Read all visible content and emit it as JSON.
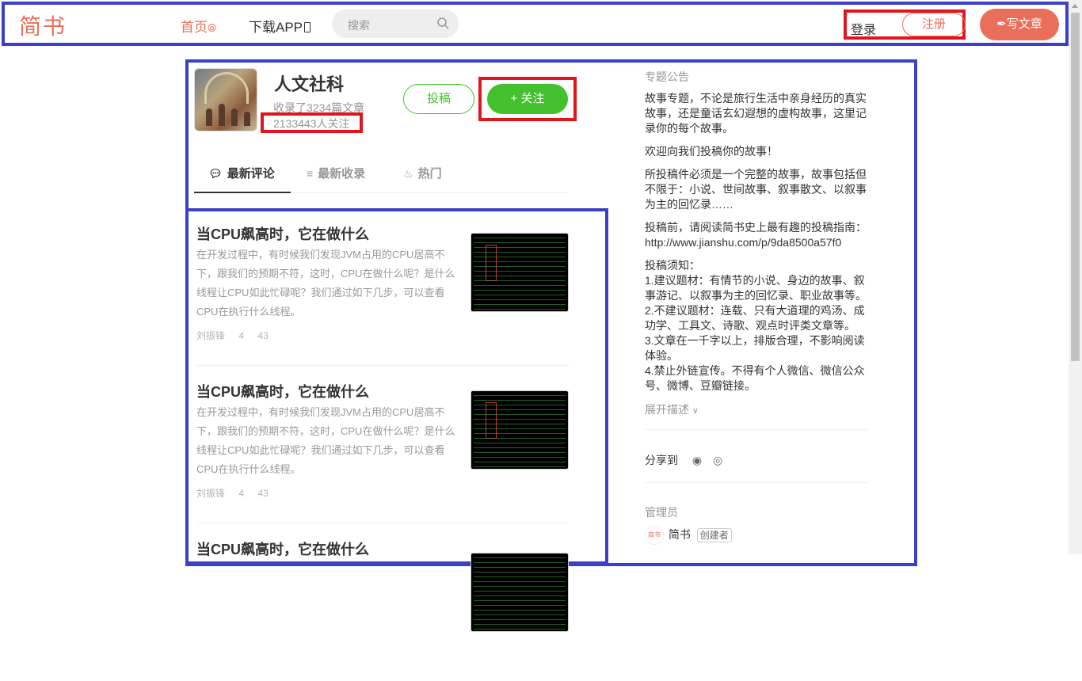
{
  "header": {
    "logo": "简书",
    "nav_home": "首页",
    "nav_app": "下载APP",
    "search_placeholder": "搜索",
    "login": "登录",
    "signup": "注册",
    "write": "写文章"
  },
  "collection": {
    "title": "人文社科",
    "article_count": "收录了3234篇文章",
    "follower_count": "2133443人关注",
    "submit_label": "投稿",
    "follow_label": "关注",
    "tabs": [
      {
        "label": "最新评论",
        "icon": "comments-icon"
      },
      {
        "label": "最新收录",
        "icon": "document-icon"
      },
      {
        "label": "热门",
        "icon": "fire-icon"
      }
    ]
  },
  "articles": [
    {
      "title": "当CPU飙高时，它在做什么",
      "abstract": "在开发过程中，有时候我们发现JVM占用的CPU居高不下，跟我们的预期不符，这时，CPU在做什么呢？是什么线程让CPU如此忙碌呢？我们通过如下几步，可以查看CPU在执行什么线程。",
      "author": "刘振锋",
      "comments": "4",
      "likes": "43"
    },
    {
      "title": "当CPU飙高时，它在做什么",
      "abstract": "在开发过程中，有时候我们发现JVM占用的CPU居高不下，跟我们的预期不符，这时，CPU在做什么呢？是什么线程让CPU如此忙碌呢？我们通过如下几步，可以查看CPU在执行什么线程。",
      "author": "刘振锋",
      "comments": "4",
      "likes": "43"
    },
    {
      "title": "当CPU飙高时，它在做什么",
      "abstract": "",
      "author": "",
      "comments": "",
      "likes": ""
    }
  ],
  "sidebar": {
    "notice_label": "专题公告",
    "para1": "故事专题，不论是旅行生活中亲身经历的真实故事，还是童话玄幻遐想的虚构故事，这里记录你的每个故事。",
    "para2": "欢迎向我们投稿你的故事！",
    "para3": "所投稿件必须是一个完整的故事，故事包括但不限于：小说、世间故事、叙事散文、以叙事为主的回忆录……",
    "para4": "投稿前，请阅读简书史上最有趣的投稿指南：http://www.jianshu.com/p/9da8500a57f0",
    "para5_title": "投稿须知：",
    "rules": [
      "1.建议题材：有情节的小说、身边的故事、叙事游记、以叙事为主的回忆录、职业故事等。",
      "2.不建议题材：连载、只有大道理的鸡汤、成功学、工具文、诗歌、观点时评类文章等。",
      "3.文章在一千字以上，排版合理，不影响阅读体验。",
      "4.禁止外链宣传。不得有个人微信、微信公众号、微博、豆瓣链接。"
    ],
    "expand": "展开描述",
    "share_label": "分享到",
    "admin_label": "管理员",
    "admin_avatar_text": "简书",
    "admin_name": "简书",
    "admin_badge": "创建者"
  },
  "colors": {
    "brand": "#ea6f5a",
    "green": "#42c02e",
    "annot_blue": "#3c3fc9",
    "annot_red": "#e2141c"
  }
}
